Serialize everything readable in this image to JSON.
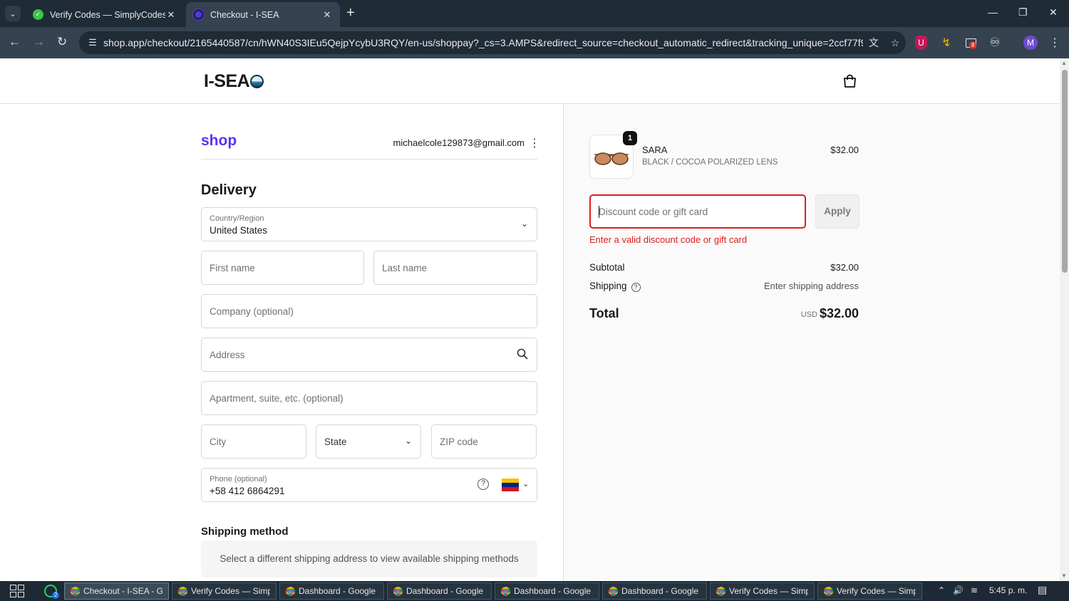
{
  "browser": {
    "tabs": [
      {
        "title": "Verify Codes — SimplyCodes",
        "active": false
      },
      {
        "title": "Checkout - I-SEA",
        "active": true
      }
    ],
    "url": "shop.app/checkout/2165440587/cn/hWN40S3IEu5QejpYcybU3RQY/en-us/shoppay?_cs=3.AMPS&redirect_source=checkout_automatic_redirect&tracking_unique=2ccf77f9-6e8e-4...",
    "extension_badge": "8",
    "profile_initial": "M"
  },
  "store": {
    "logo_text": "I-SEA"
  },
  "checkout": {
    "shop_logo": "shop",
    "email": "michaelcole129873@gmail.com",
    "delivery_heading": "Delivery",
    "country_label": "Country/Region",
    "country_value": "United States",
    "first_name_ph": "First name",
    "last_name_ph": "Last name",
    "company_ph": "Company (optional)",
    "address_ph": "Address",
    "apartment_ph": "Apartment, suite, etc. (optional)",
    "city_ph": "City",
    "state_ph": "State",
    "zip_ph": "ZIP code",
    "phone_label": "Phone (optional)",
    "phone_value": "+58 412 6864291",
    "shipping_heading": "Shipping method",
    "shipping_note": "Select a different shipping address to view available shipping methods"
  },
  "summary": {
    "item": {
      "quantity": "1",
      "name": "SARA",
      "variant": "BLACK / COCOA POLARIZED LENS",
      "price": "$32.00"
    },
    "discount_ph": "Discount code or gift card",
    "apply_label": "Apply",
    "error": "Enter a valid discount code or gift card",
    "subtotal_label": "Subtotal",
    "subtotal_value": "$32.00",
    "shipping_label": "Shipping",
    "shipping_value": "Enter shipping address",
    "total_label": "Total",
    "total_currency": "USD",
    "total_value": "$32.00"
  },
  "taskbar": {
    "apps": [
      {
        "title": "Checkout - I-SEA - G...",
        "active": true
      },
      {
        "title": "Verify Codes — Simp..."
      },
      {
        "title": "Dashboard - Google ..."
      },
      {
        "title": "Dashboard - Google ..."
      },
      {
        "title": "Dashboard - Google ..."
      },
      {
        "title": "Dashboard - Google ..."
      },
      {
        "title": "Verify Codes — Simp..."
      },
      {
        "title": "Verify Codes — Simp..."
      }
    ],
    "whatsapp_badge": "2",
    "time": "5:45 p. m."
  },
  "colors": {
    "shop_purple": "#5a31f4",
    "error_red": "#dd1d1d",
    "chrome_dark": "#1f2b35"
  }
}
